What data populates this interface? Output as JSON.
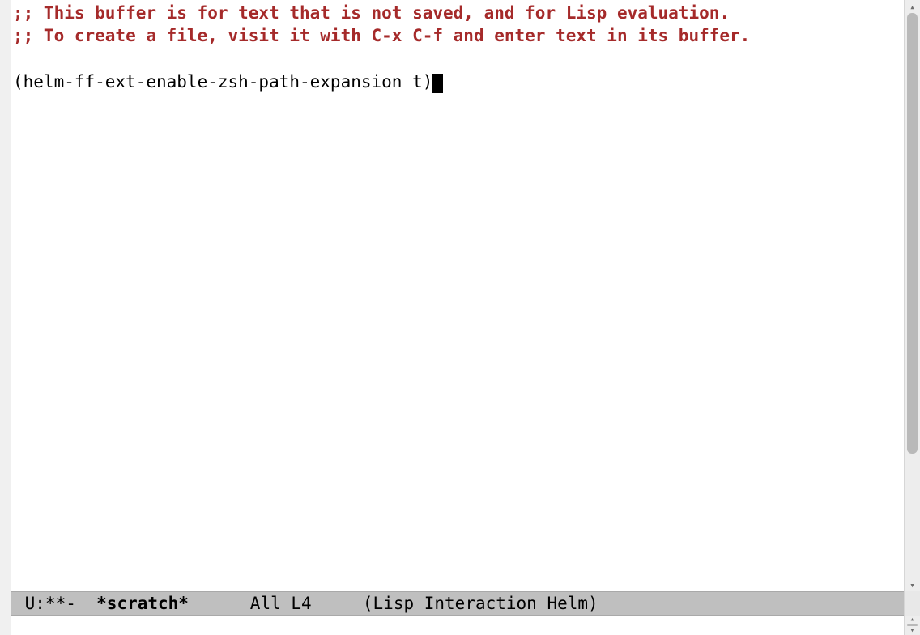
{
  "buffer": {
    "comment_line_1": ";; This buffer is for text that is not saved, and for Lisp evaluation.",
    "comment_line_2": ";; To create a file, visit it with C-x C-f and enter text in its buffer.",
    "code_line": "(helm-ff-ext-enable-zsh-path-expansion t)"
  },
  "modeline": {
    "status_prefix": " U:**-  ",
    "buffer_name": "*scratch*",
    "position_info": "      All L4     ",
    "mode_info": "(Lisp Interaction Helm)"
  }
}
